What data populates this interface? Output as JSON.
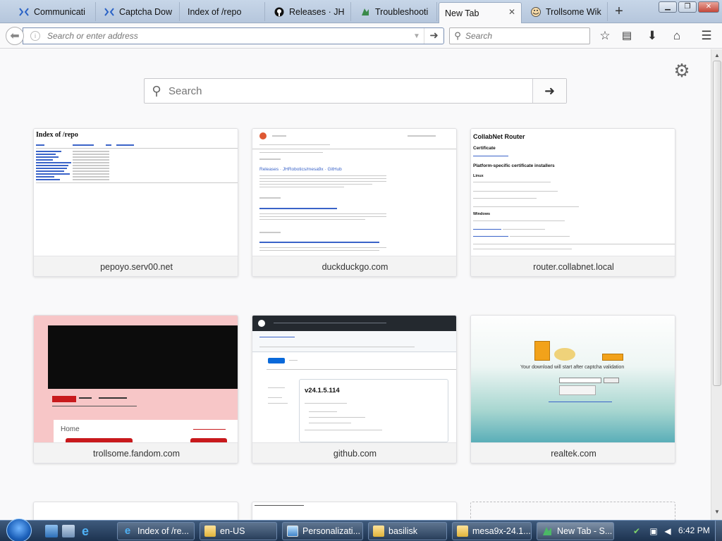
{
  "tabs": [
    {
      "title": "Communicati",
      "icon": "x-logo-icon",
      "active": false
    },
    {
      "title": "Captcha Dow",
      "icon": "x-logo-icon",
      "active": false
    },
    {
      "title": "Index of /repo",
      "icon": "",
      "active": false
    },
    {
      "title": "Releases · JHR",
      "icon": "github-icon",
      "active": false
    },
    {
      "title": "Troubleshooti",
      "icon": "wolf-icon",
      "active": false
    },
    {
      "title": "New Tab",
      "icon": "",
      "active": true
    },
    {
      "title": "Trollsome Wik",
      "icon": "troll-face-icon",
      "active": false
    }
  ],
  "navbar": {
    "url_placeholder": "Search or enter address",
    "search_placeholder": "Search"
  },
  "content": {
    "search_placeholder": "Search"
  },
  "tiles": [
    {
      "label": "pepoyo.serv00.net",
      "thumb_title": "Index of /repo"
    },
    {
      "label": "duckduckgo.com",
      "thumb_title": "Releases · JHRobotics/mesa9x · GitHub"
    },
    {
      "label": "router.collabnet.local",
      "thumb_title": "CollabNet Router",
      "thumb_sub1": "Certificate",
      "thumb_sub2": "Platform-specific certificate installers",
      "thumb_sub3": "Linux",
      "thumb_sub4": "Windows"
    },
    {
      "label": "trollsome.fandom.com",
      "thumb_title": "Home"
    },
    {
      "label": "github.com",
      "thumb_title": "v24.1.5.114"
    },
    {
      "label": "realtek.com",
      "thumb_title": "Your download will start after captcha validation"
    }
  ],
  "taskbar": {
    "items": [
      {
        "label": "Index of /re...",
        "icon": "ie-icon",
        "active": false
      },
      {
        "label": "en-US",
        "icon": "folder-icon",
        "active": false
      },
      {
        "label": "Personalizati...",
        "icon": "monitor-icon",
        "active": false
      },
      {
        "label": "basilisk",
        "icon": "folder-icon",
        "active": false
      },
      {
        "label": "mesa9x-24.1....",
        "icon": "folder-icon",
        "active": false
      },
      {
        "label": "New Tab - S...",
        "icon": "wolf-icon",
        "active": true
      }
    ],
    "clock": "6:42 PM"
  }
}
